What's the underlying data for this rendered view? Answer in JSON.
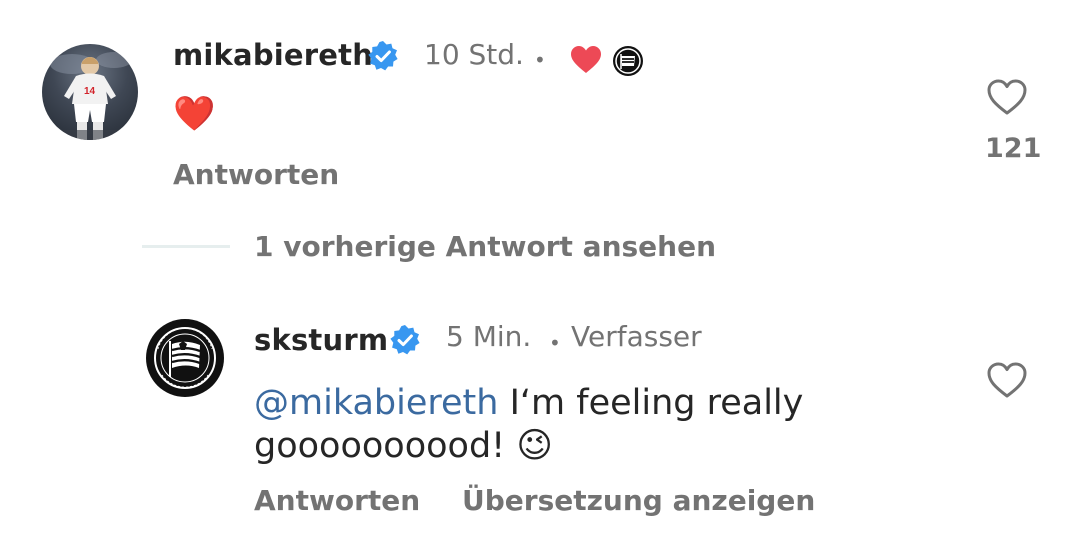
{
  "comments": [
    {
      "username": "mikabiereth",
      "verified": true,
      "time": "10 Std.",
      "separator": "•",
      "text": "❤️",
      "reply_label": "Antworten",
      "like_count": "121"
    },
    {
      "username": "sksturm",
      "verified": true,
      "time": "5 Min.",
      "separator": "•",
      "author_label": "Verfasser",
      "mention": "@mikabiereth",
      "text_line1": " I‘m feeling really",
      "text_line2": "goooooooood! ",
      "emoji": "😉",
      "reply_label": "Antworten",
      "translate_label": "Übersetzung anzeigen"
    }
  ],
  "view_replies_label": "1 vorherige Antwort ansehen",
  "avatar_logo_text": "SK STURM GRAZ · SEIT 1909",
  "colors": {
    "verified_blue": "#3897f0",
    "heart_red": "#ed4956",
    "mention_blue": "#3b6aa0",
    "secondary_text": "#737373"
  }
}
